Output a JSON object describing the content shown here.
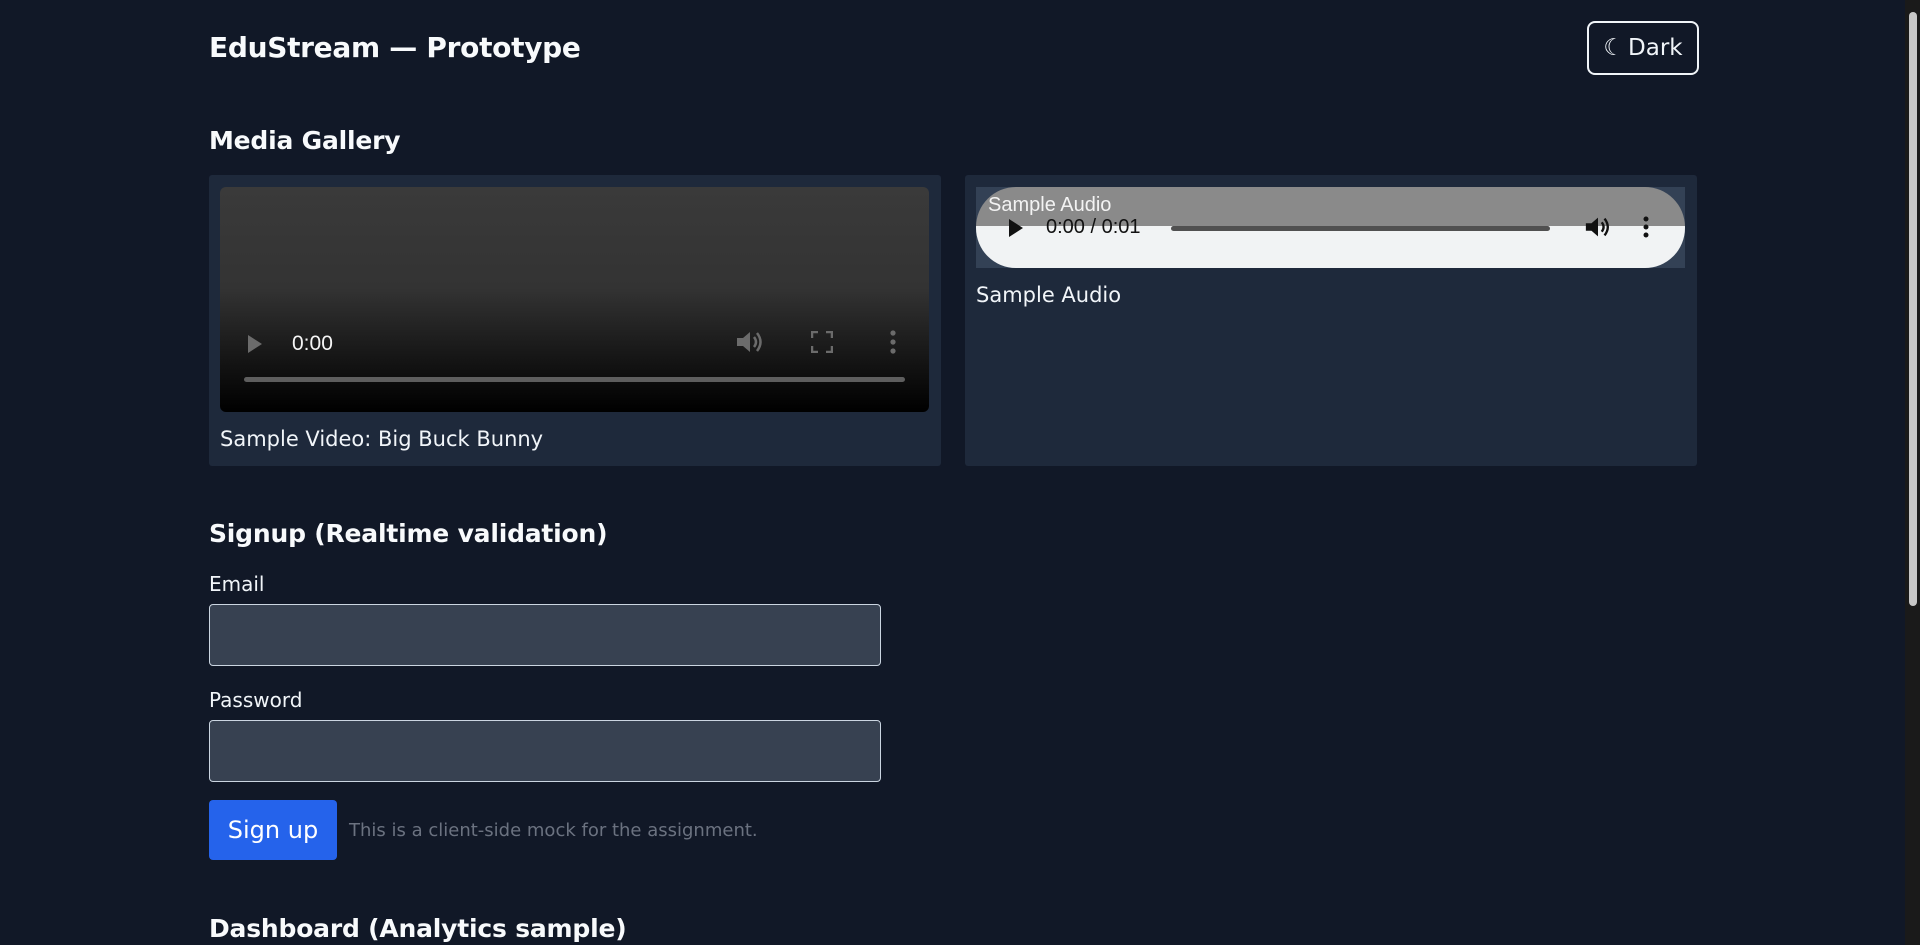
{
  "header": {
    "title": "EduStream — Prototype",
    "theme_toggle": {
      "icon": "moon-icon",
      "glyph": "☾",
      "label": "Dark"
    }
  },
  "media_gallery": {
    "title": "Media Gallery",
    "video": {
      "time": "0:00",
      "caption": "Sample Video: Big Buck Bunny"
    },
    "audio": {
      "overlay_title": "Sample Audio",
      "time": "0:00 / 0:01",
      "caption": "Sample Audio"
    }
  },
  "signup": {
    "title": "Signup (Realtime validation)",
    "email_label": "Email",
    "email_value": "",
    "password_label": "Password",
    "password_value": "",
    "submit_label": "Sign up",
    "note": "This is a client-side mock for the assignment."
  },
  "dashboard": {
    "title": "Dashboard (Analytics sample)"
  },
  "colors": {
    "background": "#111827",
    "card": "#1e293b",
    "accent": "#2563eb",
    "input": "#374151"
  }
}
